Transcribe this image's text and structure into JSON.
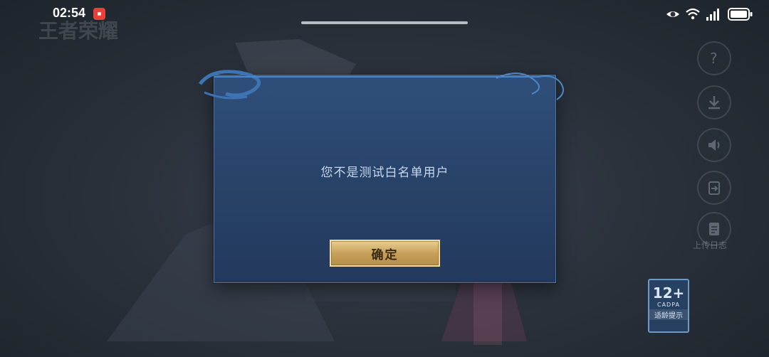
{
  "status_bar": {
    "time": "02:54",
    "battery_icon": "battery-icon",
    "signal_icon": "signal-icon",
    "wifi_icon": "wifi-icon",
    "eye_icon": "eye-comfort-icon"
  },
  "game": {
    "logo_text": "王者荣耀"
  },
  "side_menu": {
    "icons": [
      "help-icon",
      "download-icon",
      "sound-icon",
      "switch-account-icon",
      "upload-log-icon"
    ],
    "upload_log_label": "上传日志"
  },
  "dialog": {
    "message": "您不是测试白名单用户",
    "confirm_label": "确定"
  },
  "age_rating": {
    "age": "12+",
    "org": "CADPA",
    "tip": "适龄提示"
  },
  "colors": {
    "dialog_bg": "#2b4870",
    "dialog_border": "#4c78a8",
    "button_gold": "#d1ab66",
    "message_text": "#c7d8ee"
  }
}
